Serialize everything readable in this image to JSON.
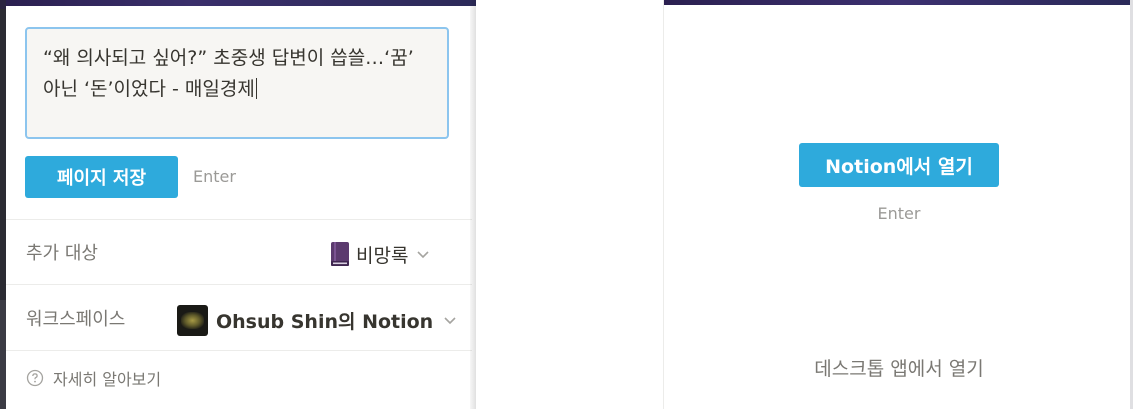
{
  "popup": {
    "page_title_value": "“왜 의사되고 싶어?” 초중생 답변이 씁쓸…‘꿈’ 아닌 ‘돈’이었다 - 매일경제",
    "save_button": "페이지 저장",
    "save_shortcut": "Enter",
    "add_to_label": "추가 대상",
    "add_to_value": "비망록",
    "add_to_icon": "book-icon",
    "workspace_label": "워크스페이스",
    "workspace_value": "Ohsub Shin의 Notion",
    "learn_more": "자세히 알아보기"
  },
  "open_panel": {
    "open_button": "Notion에서 열기",
    "open_shortcut": "Enter",
    "desktop_link": "데스크톱 앱에서 열기"
  },
  "colors": {
    "accent": "#2eaadc",
    "focus_border": "#8cc5ee",
    "book": "#5b3a6e"
  }
}
